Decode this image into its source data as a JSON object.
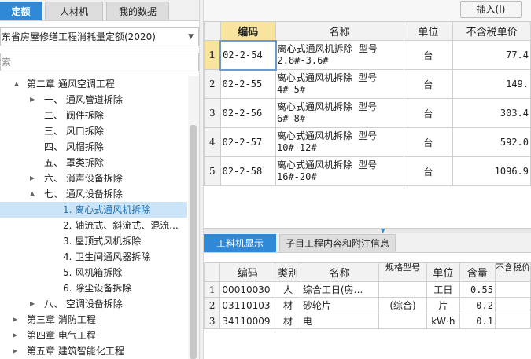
{
  "left_tabs": [
    {
      "label": "定额",
      "active": true
    },
    {
      "label": "人材机",
      "active": false
    },
    {
      "label": "我的数据",
      "active": false
    }
  ],
  "quota_library": "东省房屋修缮工程消耗量定额(2020)",
  "search_placeholder": "索",
  "tree": [
    {
      "label": "第二章 通风空调工程",
      "toggle": "▲",
      "expanded": true,
      "selected": false
    },
    {
      "label": "一、 通风管道拆除",
      "toggle": "▶",
      "expanded": false,
      "selected": false
    },
    {
      "label": "二、 阀件拆除",
      "toggle": "",
      "expanded": false,
      "selected": false
    },
    {
      "label": "三、 风口拆除",
      "toggle": "",
      "expanded": false,
      "selected": false
    },
    {
      "label": "四、 风帽拆除",
      "toggle": "",
      "expanded": false,
      "selected": false
    },
    {
      "label": "五、 罩类拆除",
      "toggle": "",
      "expanded": false,
      "selected": false
    },
    {
      "label": "六、 消声设备拆除",
      "toggle": "▶",
      "expanded": false,
      "selected": false
    },
    {
      "label": "七、 通风设备拆除",
      "toggle": "▲",
      "expanded": true,
      "selected": false
    },
    {
      "label": "1. 离心式通风机拆除",
      "toggle": "",
      "expanded": false,
      "selected": true
    },
    {
      "label": "2. 轴流式、斜流式、混流...",
      "toggle": "",
      "expanded": false,
      "selected": false
    },
    {
      "label": "3. 屋顶式风机拆除",
      "toggle": "",
      "expanded": false,
      "selected": false
    },
    {
      "label": "4. 卫生间通风器拆除",
      "toggle": "",
      "expanded": false,
      "selected": false
    },
    {
      "label": "5. 风机箱拆除",
      "toggle": "",
      "expanded": false,
      "selected": false
    },
    {
      "label": "6. 除尘设备拆除",
      "toggle": "",
      "expanded": false,
      "selected": false
    },
    {
      "label": "八、 空调设备拆除",
      "toggle": "▶",
      "expanded": false,
      "selected": false
    },
    {
      "label": "第三章 消防工程",
      "toggle": "▶",
      "expanded": false,
      "selected": false
    },
    {
      "label": "第四章 电气工程",
      "toggle": "▶",
      "expanded": false,
      "selected": false
    },
    {
      "label": "第五章 建筑智能化工程",
      "toggle": "▶",
      "expanded": false,
      "selected": false
    }
  ],
  "insert_button": "插入(I)",
  "quota_table": {
    "headers": [
      "编码",
      "名称",
      "单位",
      "不含税单价"
    ],
    "rows": [
      {
        "n": "1",
        "code": "02-2-54",
        "name": "离心式通风机拆除 型号2.8#-3.6#",
        "unit": "台",
        "price": "77.4"
      },
      {
        "n": "2",
        "code": "02-2-55",
        "name": "离心式通风机拆除 型号4#-5#",
        "unit": "台",
        "price": "149."
      },
      {
        "n": "3",
        "code": "02-2-56",
        "name": "离心式通风机拆除 型号6#-8#",
        "unit": "台",
        "price": "303.4"
      },
      {
        "n": "4",
        "code": "02-2-57",
        "name": "离心式通风机拆除 型号10#-12#",
        "unit": "台",
        "price": "592.0"
      },
      {
        "n": "5",
        "code": "02-2-58",
        "name": "离心式通风机拆除 型号16#-20#",
        "unit": "台",
        "price": "1096.9"
      }
    ]
  },
  "sub_tabs": [
    {
      "label": "工料机显示",
      "active": true
    },
    {
      "label": "子目工程内容和附注信息",
      "active": false
    }
  ],
  "resource_table": {
    "headers": [
      "编码",
      "类别",
      "名称",
      "规格型号",
      "单位",
      "含量",
      "不含税价"
    ],
    "rows": [
      {
        "n": "1",
        "code": "00010030",
        "cat": "人",
        "name": "综合工日(房…",
        "spec": "",
        "unit": "工日",
        "qty": "0.55"
      },
      {
        "n": "2",
        "code": "03110103",
        "cat": "材",
        "name": "砂轮片",
        "spec": "(综合)",
        "unit": "片",
        "qty": "0.2"
      },
      {
        "n": "3",
        "code": "34110009",
        "cat": "材",
        "name": "电",
        "spec": "",
        "unit": "kW·h",
        "qty": "0.1"
      }
    ]
  }
}
